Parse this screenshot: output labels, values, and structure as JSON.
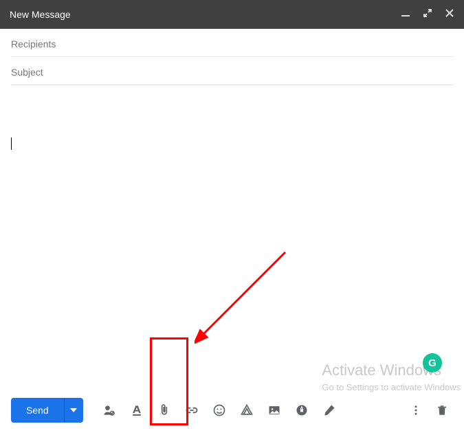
{
  "header": {
    "title": "New Message"
  },
  "fields": {
    "recipients_placeholder": "Recipients",
    "recipients_value": "",
    "subject_placeholder": "Subject",
    "subject_value": "",
    "body_value": ""
  },
  "buttons": {
    "send_label": "Send"
  },
  "watermark": {
    "title": "Activate Windows",
    "subtitle": "Go to Settings to activate Windows"
  },
  "grammarly": {
    "letter": "G"
  },
  "colors": {
    "primary": "#1a73e8",
    "annotation": "#ff0000",
    "grammarly": "#15c39a"
  }
}
